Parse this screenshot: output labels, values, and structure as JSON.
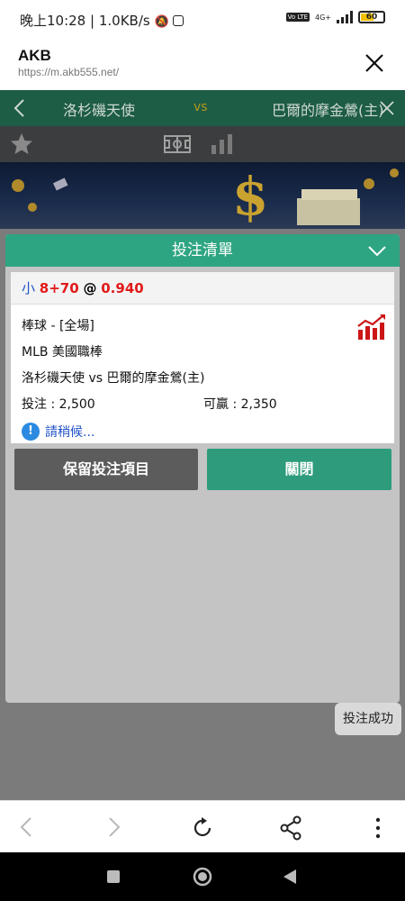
{
  "status_bar": {
    "time": "晚上10:28",
    "speed": "1.0KB/s",
    "network": "4G+",
    "battery": "60",
    "battery_level": 0.6
  },
  "browser": {
    "title": "AKB",
    "url": "https://m.akb555.net/"
  },
  "match": {
    "team_left": "洛杉磯天使",
    "vs": "vs",
    "team_right": "巴爾的摩金鶯(主)"
  },
  "betslip": {
    "title": "投注清單",
    "selection": "小",
    "line": "8+70",
    "at": "@",
    "odds": "0.940",
    "sport": "棒球 - [全場]",
    "league": "MLB 美國職棒",
    "fixture": "洛杉磯天使 vs 巴爾的摩金鶯(主)",
    "stake_label": "投注 : 2,500",
    "win_label": "可贏 : 2,350",
    "wait_text": "請稍候...",
    "keep_button": "保留投注項目",
    "close_button": "關閉"
  },
  "toast": "投注成功",
  "colors": {
    "accent": "#2ea582",
    "odds_red": "#e11a1a",
    "link_blue": "#2052c8"
  }
}
